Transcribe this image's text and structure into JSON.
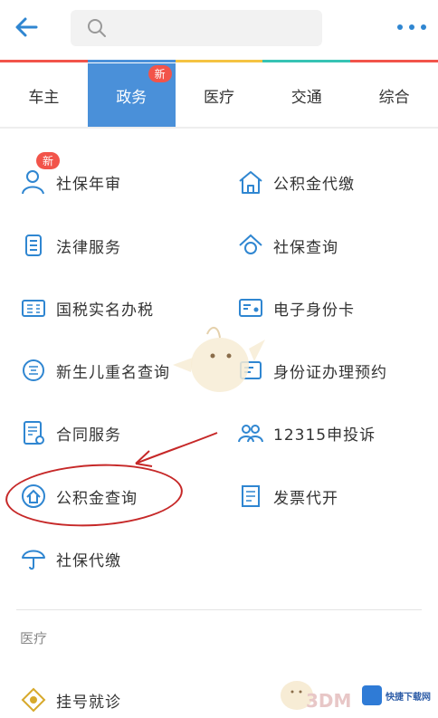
{
  "header": {
    "back_icon": "back-arrow-icon",
    "search_icon": "search-icon",
    "search_placeholder": "",
    "more_icon": "more-dots-icon",
    "accent": "#2f86d1"
  },
  "color_line": [
    "#f2544a",
    "#4a90d9",
    "#f5c342",
    "#36c3b4",
    "#f2544a"
  ],
  "tabs": [
    {
      "label": "车主"
    },
    {
      "label": "政务",
      "badge": "新"
    },
    {
      "label": "医疗"
    },
    {
      "label": "交通"
    },
    {
      "label": "综合"
    }
  ],
  "items": [
    {
      "label": "社保年审",
      "icon": "person-icon",
      "badge": "新"
    },
    {
      "label": "公积金代缴",
      "icon": "house-icon"
    },
    {
      "label": "法律服务",
      "icon": "building-icon"
    },
    {
      "label": "社保查询",
      "icon": "house-search-icon"
    },
    {
      "label": "国税实名办税",
      "icon": "tax-id-icon"
    },
    {
      "label": "电子身份卡",
      "icon": "id-card-icon"
    },
    {
      "label": "新生儿重名查询",
      "icon": "name-tag-icon"
    },
    {
      "label": "身份证办理预约",
      "icon": "id-card-appointment-icon"
    },
    {
      "label": "合同服务",
      "icon": "contract-icon"
    },
    {
      "label": "12315申投诉",
      "icon": "people-complaint-icon"
    },
    {
      "label": "公积金查询",
      "icon": "house-fund-icon"
    },
    {
      "label": "发票代开",
      "icon": "invoice-icon"
    },
    {
      "label": "社保代缴",
      "icon": "umbrella-icon"
    }
  ],
  "section2": {
    "title": "医疗",
    "items": [
      {
        "label": "挂号就诊",
        "icon": "diamond-icon"
      }
    ]
  },
  "watermark": {
    "text": "3DM",
    "badge_text": "快捷下载网"
  }
}
